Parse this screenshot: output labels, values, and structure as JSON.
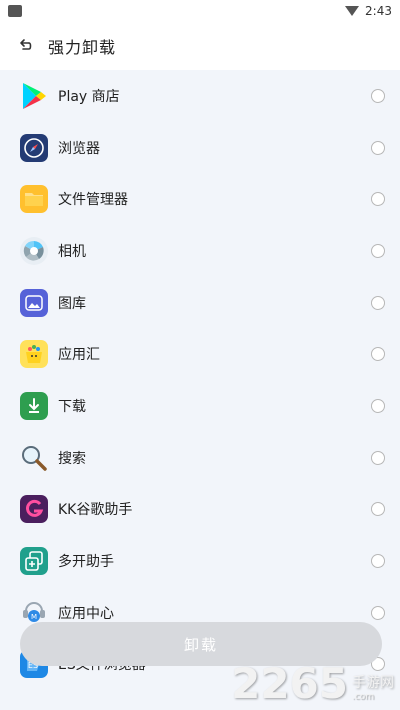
{
  "status_bar": {
    "time": "2:43"
  },
  "app_bar": {
    "title": "强力卸载"
  },
  "apps": [
    {
      "label": "Play 商店",
      "icon": "play-store-icon"
    },
    {
      "label": "浏览器",
      "icon": "browser-icon"
    },
    {
      "label": "文件管理器",
      "icon": "file-manager-icon"
    },
    {
      "label": "相机",
      "icon": "camera-icon"
    },
    {
      "label": "图库",
      "icon": "gallery-icon"
    },
    {
      "label": "应用汇",
      "icon": "appchina-icon"
    },
    {
      "label": "下载",
      "icon": "download-icon"
    },
    {
      "label": "搜索",
      "icon": "search-icon"
    },
    {
      "label": "KK谷歌助手",
      "icon": "kk-google-icon"
    },
    {
      "label": "多开助手",
      "icon": "multi-open-icon"
    },
    {
      "label": "应用中心",
      "icon": "app-center-icon"
    },
    {
      "label": "ES文件浏览器",
      "icon": "es-file-icon"
    }
  ],
  "uninstall_button": {
    "label": "卸载"
  },
  "watermark": {
    "number": "2265",
    "chinese": "手游网",
    "domain": ".com"
  }
}
